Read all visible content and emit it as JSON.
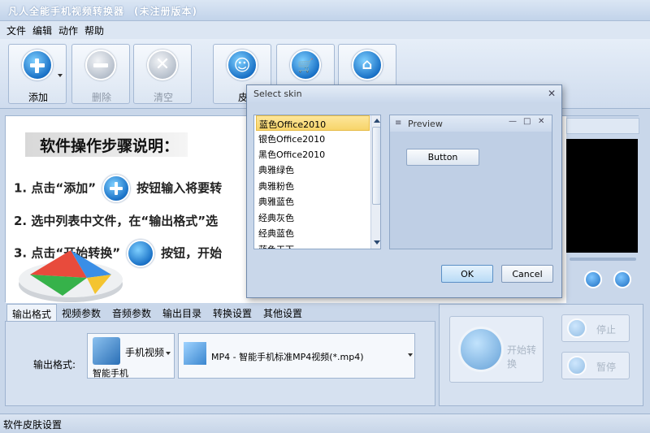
{
  "window": {
    "title": "凡人全能手机视频转换器",
    "title_suffix": "(未注册版本)"
  },
  "menu": {
    "items": [
      "文件",
      "编辑",
      "动作",
      "帮助"
    ]
  },
  "toolbar": {
    "buttons": [
      {
        "label": "添加",
        "icon": "plus-icon",
        "enabled": true
      },
      {
        "label": "删除",
        "icon": "minus-icon",
        "enabled": false
      },
      {
        "label": "清空",
        "icon": "clear-icon",
        "enabled": false
      },
      {
        "label": "皮",
        "icon": "smiley-icon",
        "enabled": true
      },
      {
        "label": "",
        "icon": "cart-icon",
        "enabled": true
      },
      {
        "label": "",
        "icon": "home-icon",
        "enabled": true
      }
    ]
  },
  "instructions": {
    "heading": "软件操作步骤说明：",
    "step1_a": "1. 点击“添加”",
    "step1_b": "按钮输入将要转",
    "step2": "2. 选中列表中文件，在“输出格式”选",
    "step3_a": "3. 点击“开始转换”",
    "step3_b": "按钮，开始"
  },
  "tabs": [
    "输出格式",
    "视频参数",
    "音频参数",
    "输出目录",
    "转换设置",
    "其他设置"
  ],
  "output_format": {
    "label": "输出格式:",
    "device_combo_text": "手机视频",
    "device_caption": "智能手机",
    "format_combo_text": "MP4 - 智能手机标准MP4视频(*.mp4)"
  },
  "actions": {
    "start": "开始转换",
    "stop": "停止",
    "pause": "暂停"
  },
  "status": {
    "text": "软件皮肤设置"
  },
  "dialog": {
    "title": "Select skin",
    "close": "✕",
    "skins": [
      "蓝色Office2010",
      "银色Office2010",
      "黑色Office2010",
      "典雅绿色",
      "典雅粉色",
      "典雅蓝色",
      "经典灰色",
      "经典蓝色",
      "蓝色天下"
    ],
    "selected_index": 0,
    "preview_title": "Preview",
    "preview_button": "Button",
    "ok": "OK",
    "cancel": "Cancel"
  }
}
